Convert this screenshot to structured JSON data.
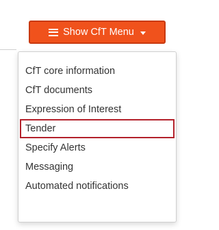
{
  "menu_button": {
    "label": "Show CfT Menu",
    "icon": "list-icon",
    "caret_icon": "caret-down-icon",
    "color": "#f0521c"
  },
  "dropdown": {
    "items": [
      {
        "label": "CfT core information"
      },
      {
        "label": "CfT documents"
      },
      {
        "label": "Expression of Interest"
      },
      {
        "label": "Tender",
        "highlighted": true
      },
      {
        "label": "Specify Alerts"
      },
      {
        "label": "Messaging"
      },
      {
        "label": "Automated notifications"
      }
    ],
    "highlight_color": "#b3202a"
  }
}
